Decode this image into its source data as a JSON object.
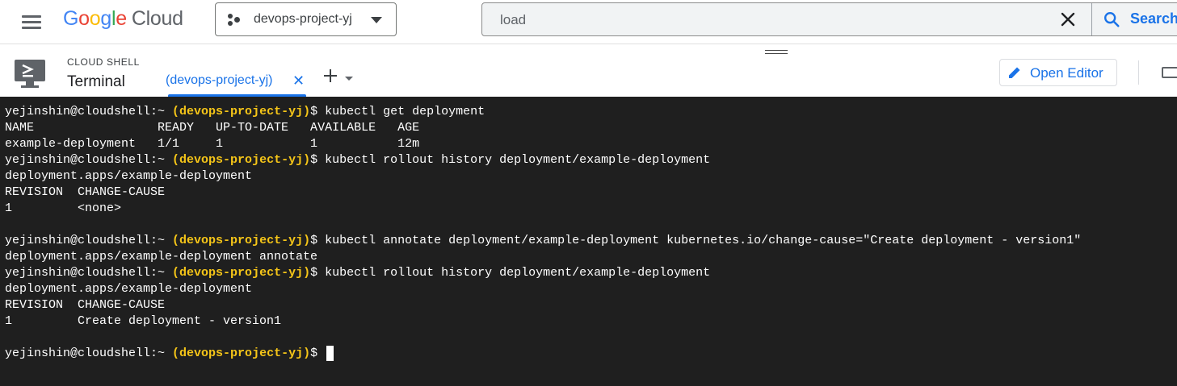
{
  "topbar": {
    "logo": {
      "g": "G",
      "o1": "o",
      "o2": "o",
      "g2": "g",
      "l": "l",
      "e": "e",
      "cloud": "Cloud"
    },
    "project_name": "devops-project-yj",
    "search": {
      "value": "load",
      "button_label": "Search"
    }
  },
  "shell": {
    "section_label": "CLOUD SHELL",
    "title": "Terminal",
    "tab_label": "(devops-project-yj)",
    "open_editor_label": "Open Editor"
  },
  "terminal": {
    "prompt_user": "yejinshin@cloudshell:~",
    "prompt_project": "(devops-project-yj)",
    "prompt_symbol": "$",
    "lines": [
      {
        "type": "cmd",
        "text": "kubectl get deployment"
      },
      {
        "type": "out",
        "text": "NAME                 READY   UP-TO-DATE   AVAILABLE   AGE"
      },
      {
        "type": "out",
        "text": "example-deployment   1/1     1            1           12m"
      },
      {
        "type": "cmd",
        "text": "kubectl rollout history deployment/example-deployment"
      },
      {
        "type": "out",
        "text": "deployment.apps/example-deployment"
      },
      {
        "type": "out",
        "text": "REVISION  CHANGE-CAUSE"
      },
      {
        "type": "out",
        "text": "1         <none>"
      },
      {
        "type": "out",
        "text": ""
      },
      {
        "type": "cmd",
        "text": "kubectl annotate deployment/example-deployment kubernetes.io/change-cause=\"Create deployment - version1\""
      },
      {
        "type": "out",
        "text": "deployment.apps/example-deployment annotate"
      },
      {
        "type": "cmd",
        "text": "kubectl rollout history deployment/example-deployment"
      },
      {
        "type": "out",
        "text": "deployment.apps/example-deployment"
      },
      {
        "type": "out",
        "text": "REVISION  CHANGE-CAUSE"
      },
      {
        "type": "out",
        "text": "1         Create deployment - version1"
      },
      {
        "type": "out",
        "text": ""
      },
      {
        "type": "prompt",
        "text": ""
      }
    ]
  },
  "colors": {
    "accent": "#1a73e8",
    "terminal_bg": "#1f1f1f",
    "prompt_project": "#f5c518"
  },
  "icons": [
    "menu-icon",
    "project-icon",
    "dropdown-icon",
    "clear-icon",
    "search-icon",
    "terminal-icon",
    "close-icon",
    "add-icon",
    "pencil-icon",
    "keyboard-icon"
  ]
}
